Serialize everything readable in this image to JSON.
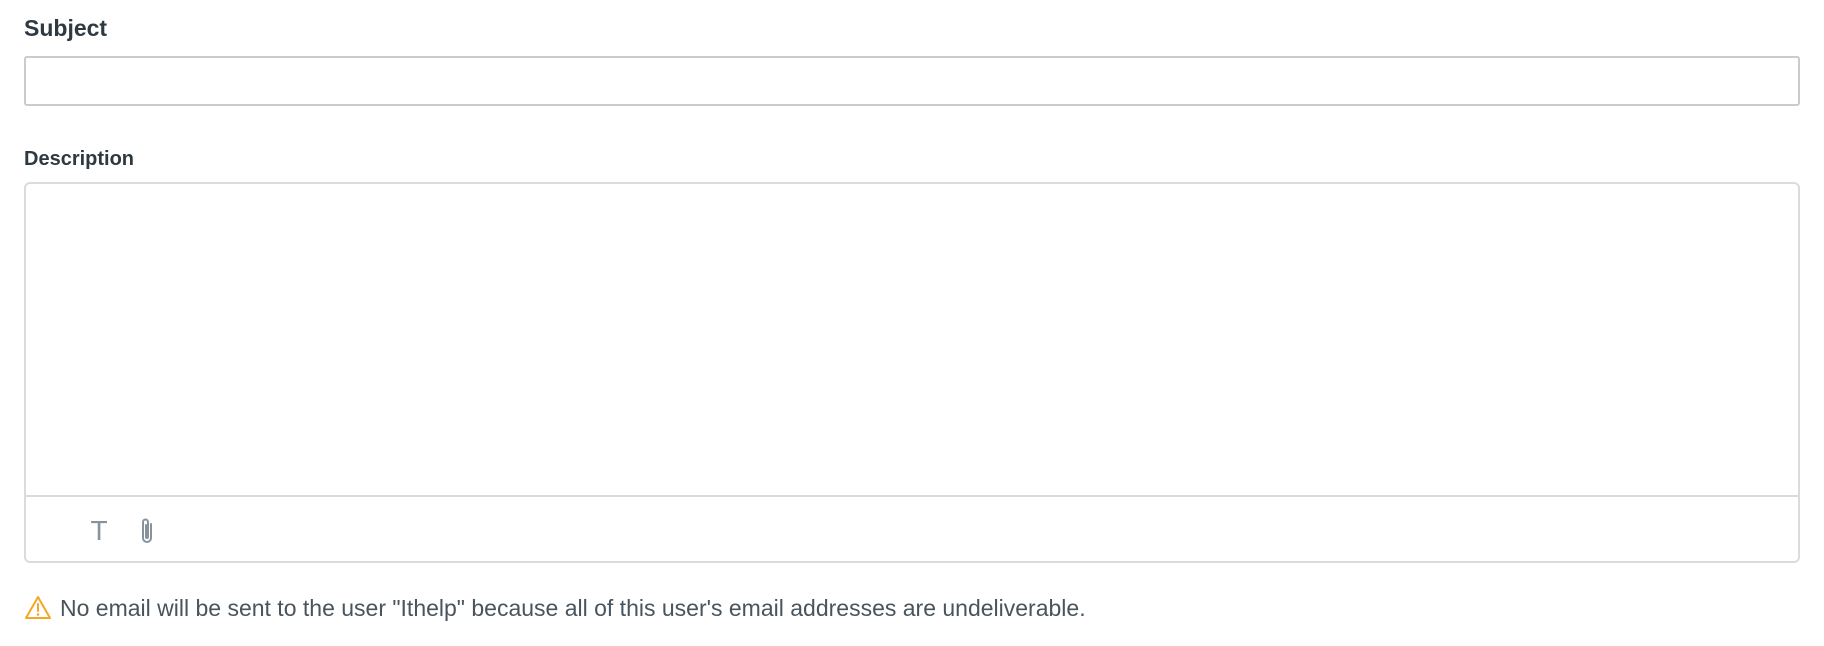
{
  "subject": {
    "label": "Subject",
    "value": "",
    "placeholder": ""
  },
  "description": {
    "label": "Description",
    "value": "",
    "placeholder": ""
  },
  "toolbar": {
    "text_format_glyph": "T",
    "text_format_icon": "text-format-icon",
    "attach_icon": "paperclip-icon"
  },
  "warning": {
    "icon": "warning-triangle-icon",
    "message": "No email will be sent to the user \"Ithelp\" because all of this user's email addresses are undeliverable."
  },
  "colors": {
    "warning": "#f5a623",
    "border": "#c9cbcd",
    "icon_gray": "#87929d",
    "text": "#2f3941"
  }
}
